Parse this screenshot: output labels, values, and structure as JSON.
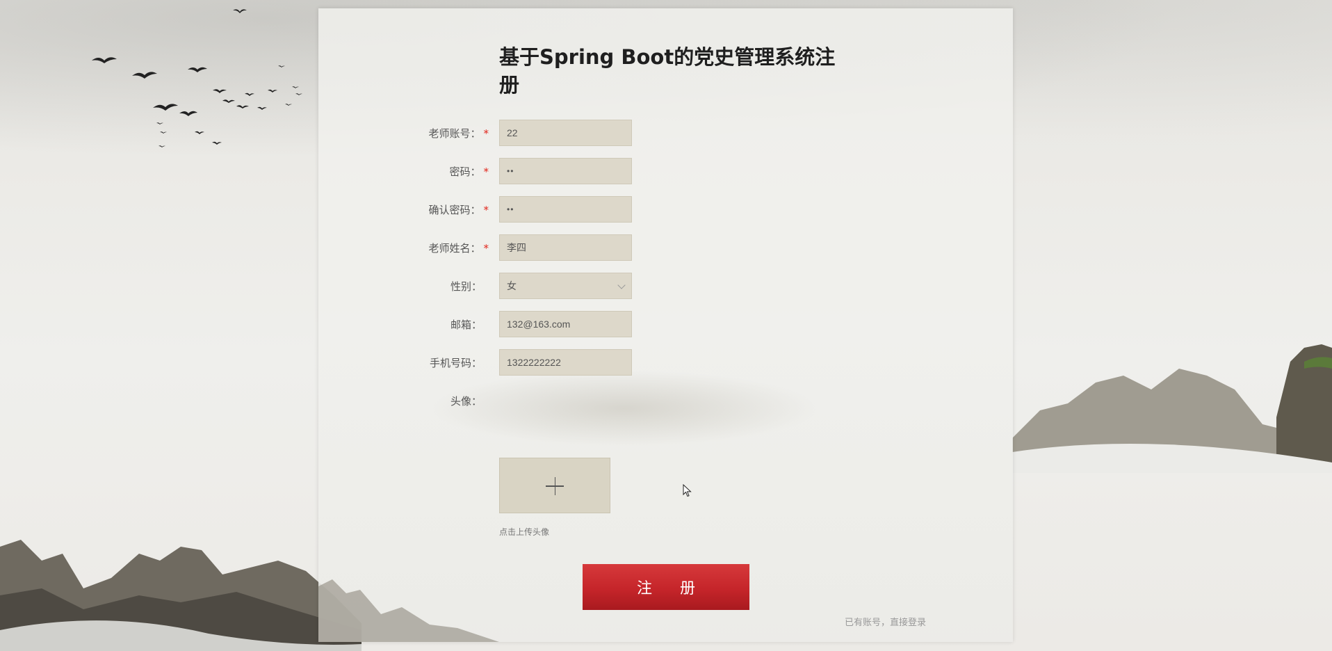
{
  "title": "基于Spring Boot的党史管理系统注册",
  "form": {
    "account_label": "老师账号：",
    "account_value": "22",
    "password_label": "密码：",
    "password_value": "••",
    "confirm_label": "确认密码：",
    "confirm_value": "••",
    "name_label": "老师姓名：",
    "name_value": "李四",
    "gender_label": "性别：",
    "gender_value": "女",
    "email_label": "邮箱：",
    "email_value": "132@163.com",
    "phone_label": "手机号码：",
    "phone_value": "1322222222",
    "avatar_label": "头像：",
    "upload_hint": "点击上传头像",
    "required_mark": "*"
  },
  "submit_label": "注册",
  "login_link": "已有账号，直接登录",
  "icons": [
    "plus-icon",
    "chevron-down-icon",
    "mouse-cursor-icon"
  ],
  "colors": {
    "accent": "#c5252a",
    "required": "#e1251b",
    "field_bg": "#ddd8ca"
  }
}
